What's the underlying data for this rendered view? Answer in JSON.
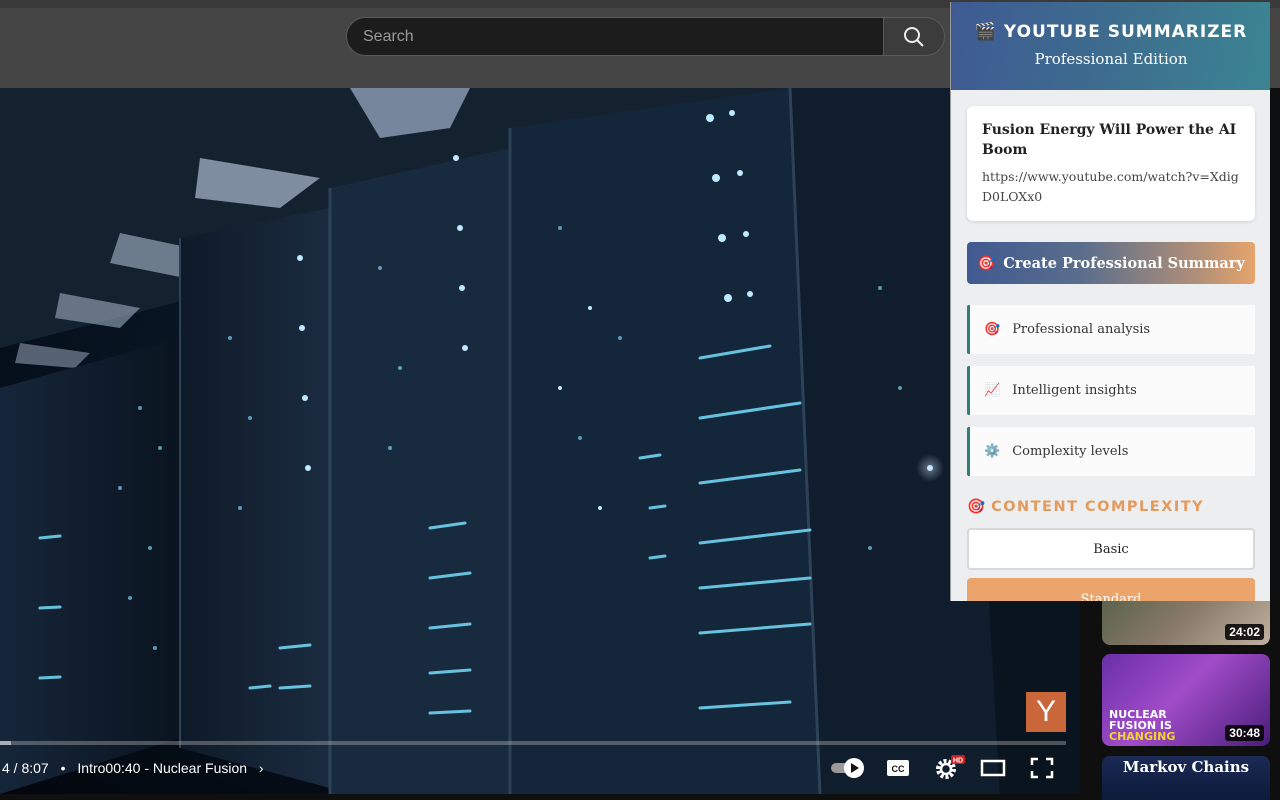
{
  "search": {
    "placeholder": "Search"
  },
  "video": {
    "time": "4 / 8:07",
    "chapter": "Intro00:40 - Nuclear Fusion",
    "progress_percent": 1,
    "channel_logo_letter": "Y",
    "autoplay_on": true,
    "settings_badge": "HD"
  },
  "sidebar": {
    "thumbnails": [
      {
        "duration": "24:02"
      },
      {
        "duration": "30:48",
        "overlay_text": [
          "NUCLEAR",
          "FUSION IS",
          "CHANGING"
        ]
      },
      {
        "overlay_text": [
          "Markov Chains"
        ]
      }
    ]
  },
  "popup": {
    "title": "YOUTUBE SUMMARIZER",
    "title_icon": "clapperboard-icon",
    "subtitle": "Professional Edition",
    "video_title": "Fusion Energy Will Power the AI Boom",
    "video_url": "https://www.youtube.com/watch?v=XdigD0LOXx0",
    "create_button": "Create Professional Summary",
    "features": [
      {
        "icon": "target-icon",
        "label": "Professional analysis"
      },
      {
        "icon": "chart-increasing-icon",
        "label": "Intelligent insights"
      },
      {
        "icon": "gear-icon",
        "label": "Complexity levels"
      }
    ],
    "complexity_heading": "CONTENT COMPLEXITY",
    "levels": [
      "Basic",
      "Standard"
    ],
    "selected_level": "Standard",
    "colors": {
      "header_start": "#3e5a93",
      "header_end": "#3c8594",
      "accent_orange": "#e49a5c",
      "feature_border": "#2f7c7a"
    }
  }
}
